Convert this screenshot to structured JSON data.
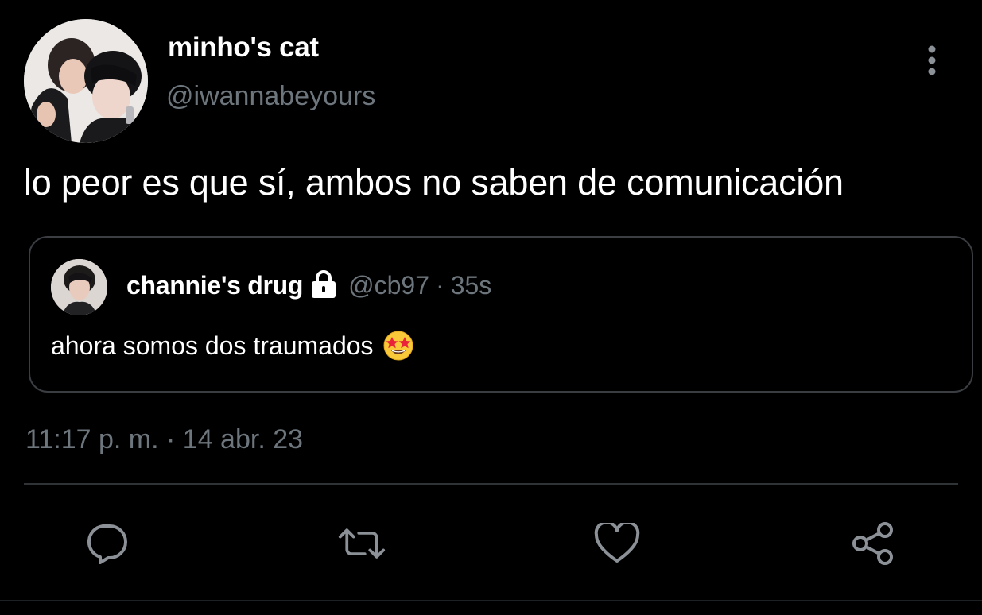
{
  "tweet": {
    "author": {
      "display_name": "minho's cat",
      "handle": "@iwannabeyours"
    },
    "text": "lo peor es que sí, ambos no saben de comunicación",
    "timestamp": "11:17 p. m. · 14 abr. 23"
  },
  "quote": {
    "author": {
      "display_name": "channie's drug",
      "handle": "@cb97",
      "protected": true
    },
    "separator": "·",
    "time_ago": "35s",
    "text": "ahora somos dos traumados",
    "emoji": "star-struck"
  },
  "actions": {
    "reply": "reply-icon",
    "retweet": "retweet-icon",
    "like": "heart-icon",
    "share": "share-icon"
  },
  "colors": {
    "background": "#000000",
    "primary_text": "#ffffff",
    "secondary_text": "#6e767d",
    "border": "#3a3d41",
    "divider": "#2f3336"
  }
}
